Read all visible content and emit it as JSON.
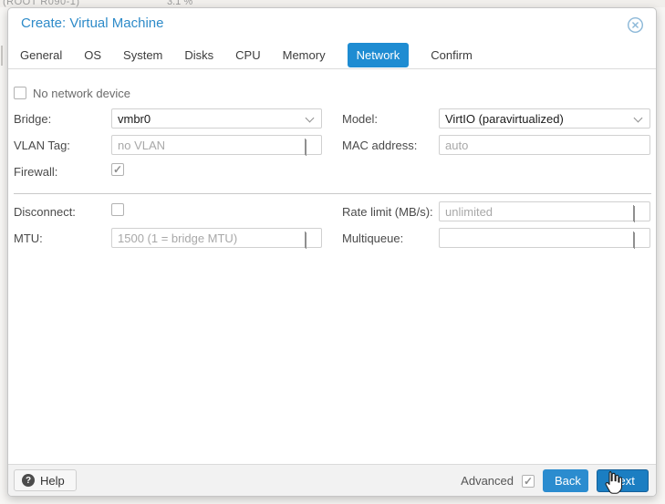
{
  "backdrop": {
    "top_text_left": "(ROOT R090-1)",
    "top_text_right": "3.1 %"
  },
  "window": {
    "title": "Create: Virtual Machine",
    "close_icon": "close-circle-icon",
    "tabs": [
      {
        "label": "General",
        "active": false
      },
      {
        "label": "OS",
        "active": false
      },
      {
        "label": "System",
        "active": false
      },
      {
        "label": "Disks",
        "active": false
      },
      {
        "label": "CPU",
        "active": false
      },
      {
        "label": "Memory",
        "active": false
      },
      {
        "label": "Network",
        "active": true
      },
      {
        "label": "Confirm",
        "active": false
      }
    ],
    "form": {
      "no_network_device": {
        "label": "No network device",
        "checked": false
      },
      "bridge": {
        "label": "Bridge:",
        "value": "vmbr0",
        "type": "combo"
      },
      "vlan_tag": {
        "label": "VLAN Tag:",
        "placeholder": "no VLAN",
        "type": "spinner"
      },
      "firewall": {
        "label": "Firewall:",
        "checked": true
      },
      "model": {
        "label": "Model:",
        "value": "VirtIO (paravirtualized)",
        "type": "combo"
      },
      "mac_address": {
        "label": "MAC address:",
        "placeholder": "auto",
        "type": "text"
      },
      "disconnect": {
        "label": "Disconnect:",
        "checked": false
      },
      "mtu": {
        "label": "MTU:",
        "placeholder": "1500 (1 = bridge MTU)",
        "type": "spinner"
      },
      "rate_limit": {
        "label": "Rate limit (MB/s):",
        "placeholder": "unlimited",
        "type": "spinner"
      },
      "multiqueue": {
        "label": "Multiqueue:",
        "placeholder": "",
        "type": "spinner"
      }
    },
    "footer": {
      "help_label": "Help",
      "help_icon": "question-circle-icon",
      "advanced": {
        "label": "Advanced",
        "checked": true
      },
      "back_label": "Back",
      "next_label": "Next"
    }
  },
  "cursor": "hand-pointer over Next button",
  "colors": {
    "accent_blue": "#1e8cd2",
    "title_blue": "#2e8bc9",
    "button_blue": "#2b8ccf",
    "button_blue_pressed": "#1b7ec2",
    "field_border": "#d0d0d0",
    "placeholder_gray": "#a8a8a8",
    "footer_bg": "#f2f2f2"
  }
}
